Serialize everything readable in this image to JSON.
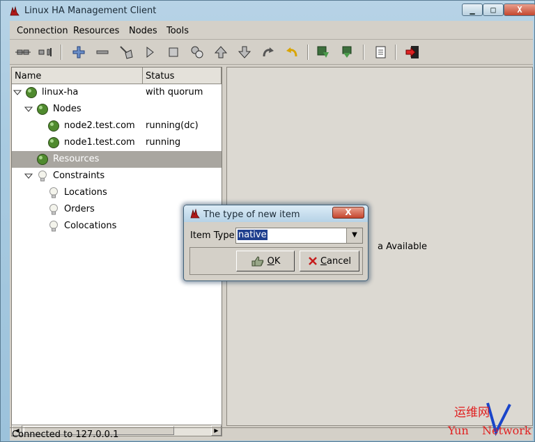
{
  "window": {
    "title": "Linux HA Management Client",
    "controls": {
      "minimize": "▁",
      "maximize": "□",
      "close": "X"
    }
  },
  "menubar": [
    "Connection",
    "Resources",
    "Nodes",
    "Tools"
  ],
  "toolbar": [
    "connect-icon",
    "disconnect-icon",
    "add-icon",
    "remove-icon",
    "cleanup-icon",
    "start-icon",
    "stop-icon",
    "migrate-icon",
    "up-icon",
    "down-icon",
    "redo-icon",
    "undo-icon",
    "standby-icon",
    "active-icon",
    "log-icon",
    "exit-icon"
  ],
  "tree": {
    "columns": {
      "name": "Name",
      "status": "Status"
    },
    "rows": [
      {
        "label": "linux-ha",
        "status": "with quorum",
        "icon": "green-ball-icon"
      },
      {
        "label": "Nodes",
        "status": "",
        "icon": "green-ball-icon"
      },
      {
        "label": "node2.test.com",
        "status": "running(dc)",
        "icon": "green-ball-icon"
      },
      {
        "label": "node1.test.com",
        "status": "running",
        "icon": "green-ball-icon"
      },
      {
        "label": "Resources",
        "status": "",
        "icon": "green-ball-icon"
      },
      {
        "label": "Constraints",
        "status": "",
        "icon": "bulb-icon"
      },
      {
        "label": "Locations",
        "status": "",
        "icon": "bulb-icon"
      },
      {
        "label": "Orders",
        "status": "",
        "icon": "bulb-icon"
      },
      {
        "label": "Colocations",
        "status": "",
        "icon": "bulb-icon"
      }
    ]
  },
  "right_panel": {
    "text": "a Available"
  },
  "statusbar": {
    "text": "Connected to 127.0.0.1"
  },
  "dialog": {
    "title": "The type of new item",
    "close": "X",
    "label": "Item Type:",
    "combo_value": "native",
    "ok_prefix": "",
    "ok_key": "O",
    "ok_rest": "K",
    "cancel_key": "C",
    "cancel_rest": "ancel"
  },
  "watermark": {
    "line1": "运维网",
    "line2_a": "Yun",
    "line2_b": "Network"
  },
  "colors": {
    "selection": "#a9a6a0",
    "highlight": "#1f3f8e",
    "close_red": "#c4462e"
  }
}
